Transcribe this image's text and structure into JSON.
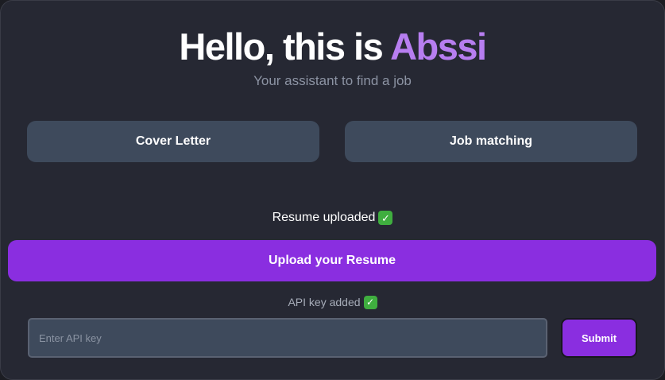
{
  "header": {
    "title_prefix": "Hello, this is ",
    "title_brand": "Abssi",
    "subtitle": "Your assistant to find a job",
    "brand_color": "#b77ef0"
  },
  "tabs": [
    {
      "label": "Cover Letter"
    },
    {
      "label": "Job matching"
    }
  ],
  "resume": {
    "status_text": "Resume uploaded",
    "status_icon": "check-mark-icon",
    "upload_label": "Upload your Resume"
  },
  "api": {
    "status_text": "API key added",
    "status_icon": "check-mark-icon",
    "placeholder": "Enter API key",
    "value": "",
    "submit_label": "Submit"
  },
  "colors": {
    "accent": "#8a2ee0",
    "panel": "#262833",
    "button": "#3e4a5c",
    "success": "#3fae3f"
  }
}
